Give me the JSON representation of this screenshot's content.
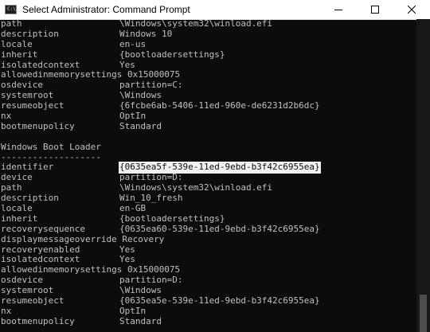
{
  "window": {
    "title": "Select Administrator: Command Prompt",
    "icon": "cmd-icon",
    "icon_text": "C:\\"
  },
  "controls": {
    "minimize": "minimize-icon",
    "maximize": "maximize-icon",
    "close": "close-icon"
  },
  "console_lines": [
    {
      "key": "path",
      "value": "\\Windows\\system32\\winload.efi"
    },
    {
      "key": "description",
      "value": "Windows 10"
    },
    {
      "key": "locale",
      "value": "en-us"
    },
    {
      "key": "inherit",
      "value": "{bootloadersettings}"
    },
    {
      "key": "isolatedcontext",
      "value": "Yes"
    },
    {
      "key": "allowedinmemorysettings",
      "value": "0x15000075"
    },
    {
      "key": "osdevice",
      "value": "partition=C:"
    },
    {
      "key": "systemroot",
      "value": "\\Windows"
    },
    {
      "key": "resumeobject",
      "value": "{6fcbe6ab-5406-11ed-960e-de6231d2b6dc}"
    },
    {
      "key": "nx",
      "value": "OptIn"
    },
    {
      "key": "bootmenupolicy",
      "value": "Standard"
    },
    {
      "key": "",
      "value": ""
    },
    {
      "key": "Windows Boot Loader",
      "value": ""
    },
    {
      "key": "-------------------",
      "value": ""
    },
    {
      "key": "identifier",
      "value": "{0635ea5f-539e-11ed-9ebd-b3f42c6955ea}",
      "selected": true
    },
    {
      "key": "device",
      "value": "partition=D:"
    },
    {
      "key": "path",
      "value": "\\Windows\\system32\\winload.efi"
    },
    {
      "key": "description",
      "value": "Win_10_fresh"
    },
    {
      "key": "locale",
      "value": "en-GB"
    },
    {
      "key": "inherit",
      "value": "{bootloadersettings}"
    },
    {
      "key": "recoverysequence",
      "value": "{0635ea60-539e-11ed-9ebd-b3f42c6955ea}"
    },
    {
      "key": "displaymessageoverride",
      "value": "Recovery"
    },
    {
      "key": "recoveryenabled",
      "value": "Yes"
    },
    {
      "key": "isolatedcontext",
      "value": "Yes"
    },
    {
      "key": "allowedinmemorysettings",
      "value": "0x15000075"
    },
    {
      "key": "osdevice",
      "value": "partition=D:"
    },
    {
      "key": "systemroot",
      "value": "\\Windows"
    },
    {
      "key": "resumeobject",
      "value": "{0635ea5e-539e-11ed-9ebd-b3f42c6955ea}"
    },
    {
      "key": "nx",
      "value": "OptIn"
    },
    {
      "key": "bootmenupolicy",
      "value": "Standard"
    }
  ],
  "scrollbar": {
    "position": 1.0,
    "visible_fraction": 0.12
  },
  "colors": {
    "console_bg": "#0c0c0c",
    "console_text": "#c0c0c0",
    "selection_bg": "#f0f0f0",
    "titlebar_bg": "#ffffff"
  }
}
